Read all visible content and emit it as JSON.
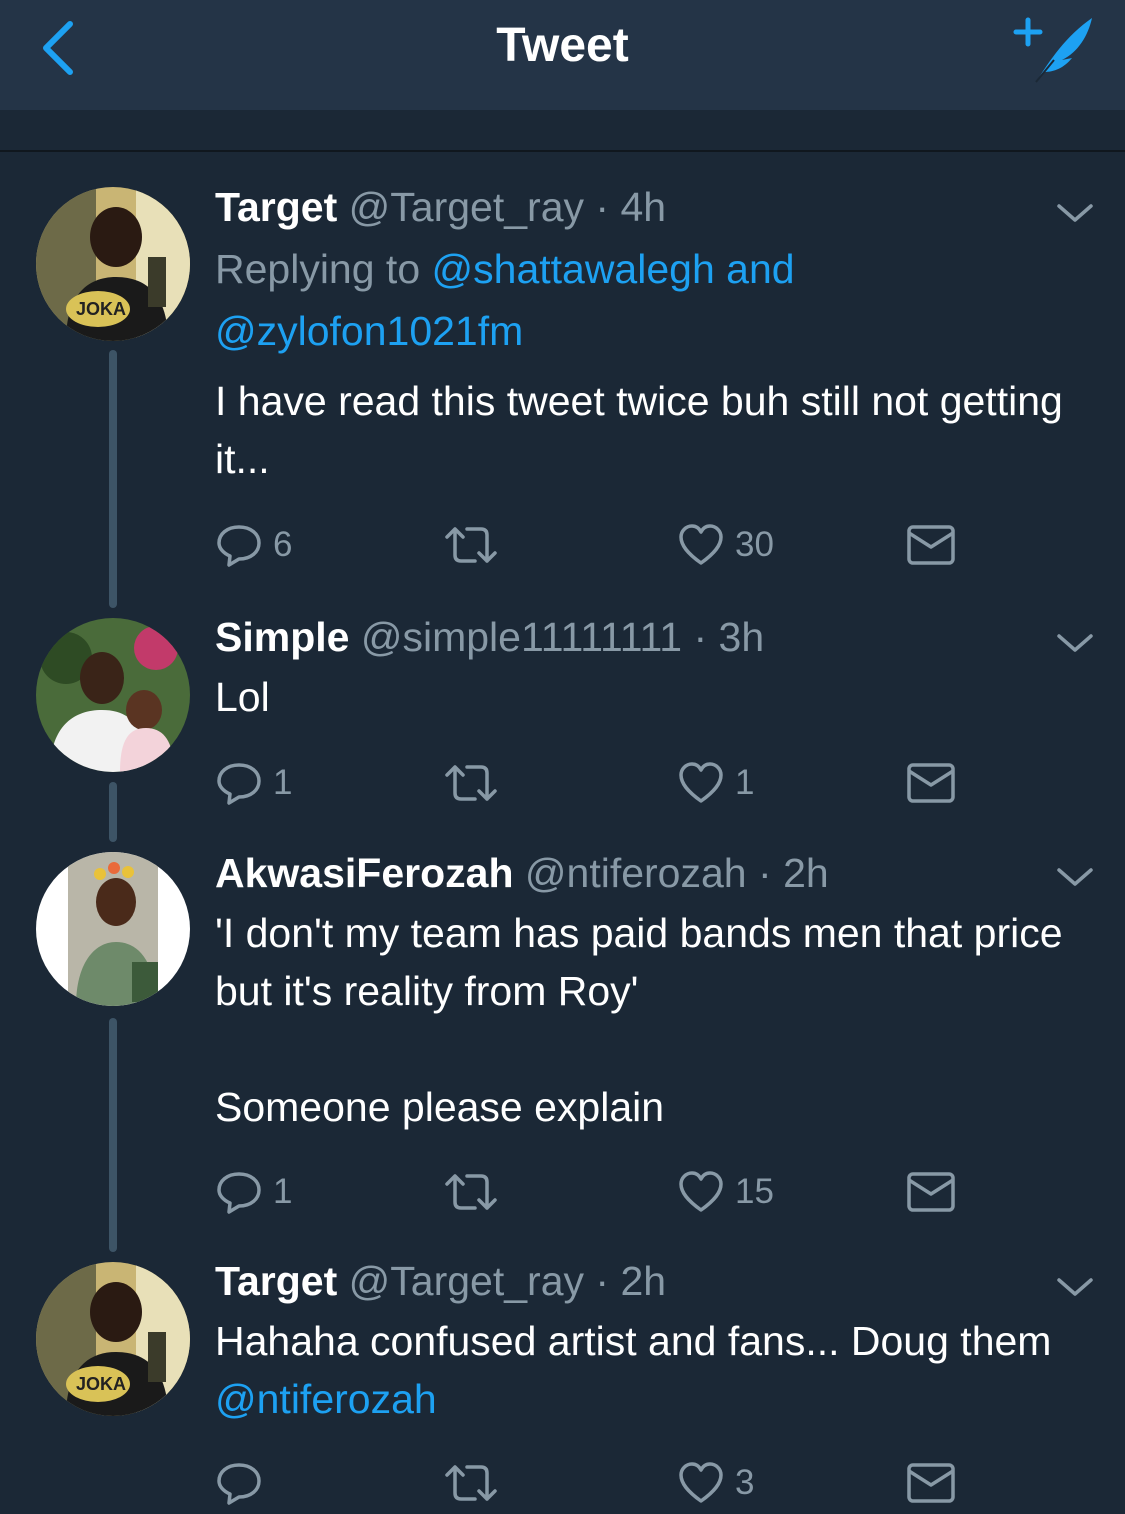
{
  "header": {
    "title": "Tweet"
  },
  "tweets": [
    {
      "name": "Target",
      "handle": "@Target_ray",
      "separator": "·",
      "time": "4h",
      "reply_prefix": "Replying to ",
      "reply_handle_1": "@shattawalegh",
      "reply_and": " and",
      "reply_handle_2": "@zylofon1021fm",
      "text": "I have read this tweet twice buh still not getting it...",
      "replies": "6",
      "likes": "30"
    },
    {
      "name": "Simple",
      "handle": "@simple11111111",
      "separator": "·",
      "time": "3h",
      "text": "Lol",
      "replies": "1",
      "likes": "1"
    },
    {
      "name": "AkwasiFerozah",
      "handle": "@ntiferozah",
      "separator": "·",
      "time": "2h",
      "text": "'I don't my team has paid bands men that price but it's reality from Roy'\n\nSomeone please explain",
      "replies": "1",
      "likes": "15"
    },
    {
      "name": "Target",
      "handle": "@Target_ray",
      "separator": "·",
      "time": "2h",
      "text": "Hahaha confused artist and fans... Doug them ",
      "mention": "@ntiferozah",
      "replies": "",
      "likes": "3"
    }
  ],
  "colors": {
    "background": "#1b2836",
    "topbar": "#243447",
    "accent": "#1da1f2",
    "muted": "#8899a6"
  },
  "icons": [
    "back-chevron-icon",
    "compose-tweet-icon",
    "reply-icon",
    "retweet-icon",
    "heart-icon",
    "direct-message-icon",
    "chevron-down-icon"
  ]
}
